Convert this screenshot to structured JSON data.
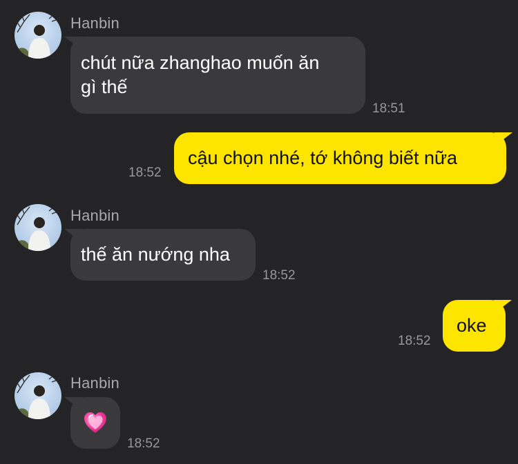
{
  "colors": {
    "background": "#242426",
    "incoming_bubble": "#3a3a3c",
    "outgoing_bubble": "#fee500",
    "timestamp": "#98989c",
    "sender_name": "#a9a9ad"
  },
  "messages": [
    {
      "direction": "incoming",
      "sender": "Hanbin",
      "avatar": "avatar-photo",
      "text": "chút nữa zhanghao muốn ăn\ngì thế",
      "time": "18:51"
    },
    {
      "direction": "outgoing",
      "text": "cậu chọn nhé, tớ không biết nữa",
      "time": "18:52"
    },
    {
      "direction": "incoming",
      "sender": "Hanbin",
      "avatar": "avatar-photo",
      "text": "thế ăn nướng nha",
      "time": "18:52"
    },
    {
      "direction": "outgoing",
      "text": "oke",
      "time": "18:52"
    },
    {
      "direction": "incoming",
      "sender": "Hanbin",
      "avatar": "avatar-photo",
      "emoji": "sparkling-heart-icon",
      "time": "18:52"
    }
  ]
}
